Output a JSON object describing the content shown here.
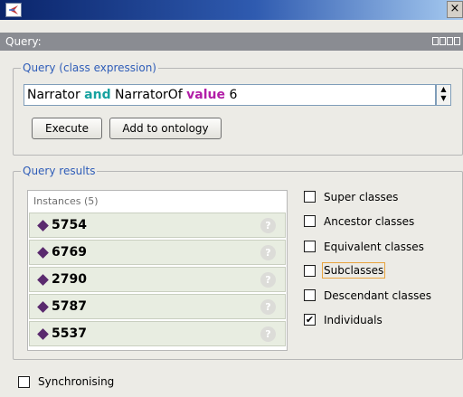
{
  "window": {
    "close_glyph": "×"
  },
  "view": {
    "title": "Query:"
  },
  "query_group": {
    "legend": "Query (class expression)"
  },
  "expression": {
    "part1": "Narrator ",
    "kw_and": "and",
    "part2": " NarratorOf ",
    "kw_value": "value",
    "part3": " 6"
  },
  "buttons": {
    "execute": "Execute",
    "add": "Add to ontology"
  },
  "results_group": {
    "legend": "Query results"
  },
  "results": {
    "header": "Instances (5)",
    "items": [
      {
        "value": "5754"
      },
      {
        "value": "6769"
      },
      {
        "value": "2790"
      },
      {
        "value": "5787"
      },
      {
        "value": "5537"
      }
    ],
    "help_glyph": "?"
  },
  "options": [
    {
      "label": "Super classes",
      "checked": false
    },
    {
      "label": "Ancestor classes",
      "checked": false
    },
    {
      "label": "Equivalent classes",
      "checked": false
    },
    {
      "label": "Subclasses",
      "checked": false
    },
    {
      "label": "Descendant classes",
      "checked": false
    },
    {
      "label": "Individuals",
      "checked": true
    }
  ],
  "sync": {
    "label": "Synchronising",
    "checked": false
  },
  "colors": {
    "keyword_and": "#17a2a0",
    "keyword_value": "#b21ea7",
    "legend": "#2f5db8",
    "individual_diamond": "#5a2a6e",
    "row_bg": "#e8ede1"
  }
}
